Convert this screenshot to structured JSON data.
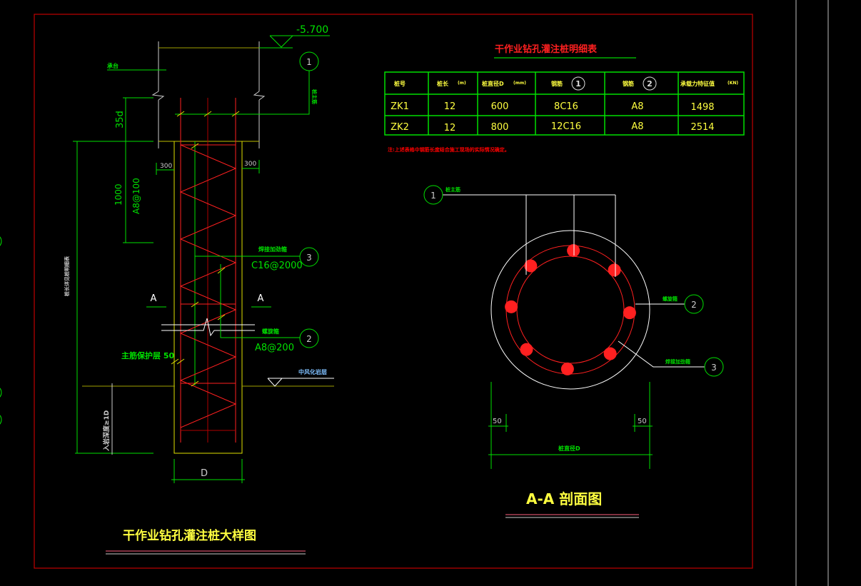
{
  "colors": {
    "background": "#000000",
    "frame": "#c00000",
    "dimension": "#00e000",
    "rebar": "#ff2020",
    "pile": "#e0e000",
    "text_yellow": "#ffff40",
    "note": "#ff0000",
    "water": "#80c0ff"
  },
  "detail": {
    "elevation": "-5.700",
    "cap_label": "承台",
    "rebar1_label": "桩主筋",
    "dim_35d": "35d",
    "dim_1000": "1000",
    "dense_stirrup": "A8@100",
    "side_300_left": "300",
    "side_300_right": "300",
    "section_a_left": "A",
    "section_a_right": "A",
    "rebar3_label": "焊接加劲箍",
    "rebar3_spec": "C16@2000",
    "rebar2_label": "螺旋箍",
    "rebar2_spec": "A8@200",
    "cover_label": "主筋保护层 50",
    "pile_length_label": "桩长详见桩明细表",
    "rock_label": "中风化岩层",
    "embed_label": "入岩深度≥1D",
    "dim_d": "D",
    "markers": {
      "m1": "1",
      "m2": "2",
      "m3": "3"
    },
    "title": "干作业钻孔灌注桩大样图"
  },
  "table": {
    "title": "干作业钻孔灌注桩明细表",
    "headers": [
      {
        "label": "桩号",
        "unit": ""
      },
      {
        "label": "桩长",
        "unit": "(m)"
      },
      {
        "label": "桩直径D",
        "unit": "(mm)"
      },
      {
        "label": "钢筋",
        "marker": "1"
      },
      {
        "label": "钢筋",
        "marker": "2"
      },
      {
        "label": "承载力特征值",
        "unit": "(KN)"
      }
    ],
    "rows": [
      [
        "ZK1",
        "12",
        "600",
        "8C16",
        "A8",
        "1498"
      ],
      [
        "ZK2",
        "12",
        "800",
        "12C16",
        "A8",
        "2514"
      ]
    ],
    "note": "注:上述表格中钢筋长度结合施工现场的实际情况确定。"
  },
  "section": {
    "title": "A-A 剖面图",
    "rebar1_label": "桩主筋",
    "rebar2_label": "螺旋箍",
    "rebar3_label": "焊接加劲箍",
    "cover_left": "50",
    "cover_right": "50",
    "diameter_label": "桩直径D",
    "markers": {
      "m1": "1",
      "m2": "2",
      "m3": "3"
    },
    "bar_count": 8
  }
}
